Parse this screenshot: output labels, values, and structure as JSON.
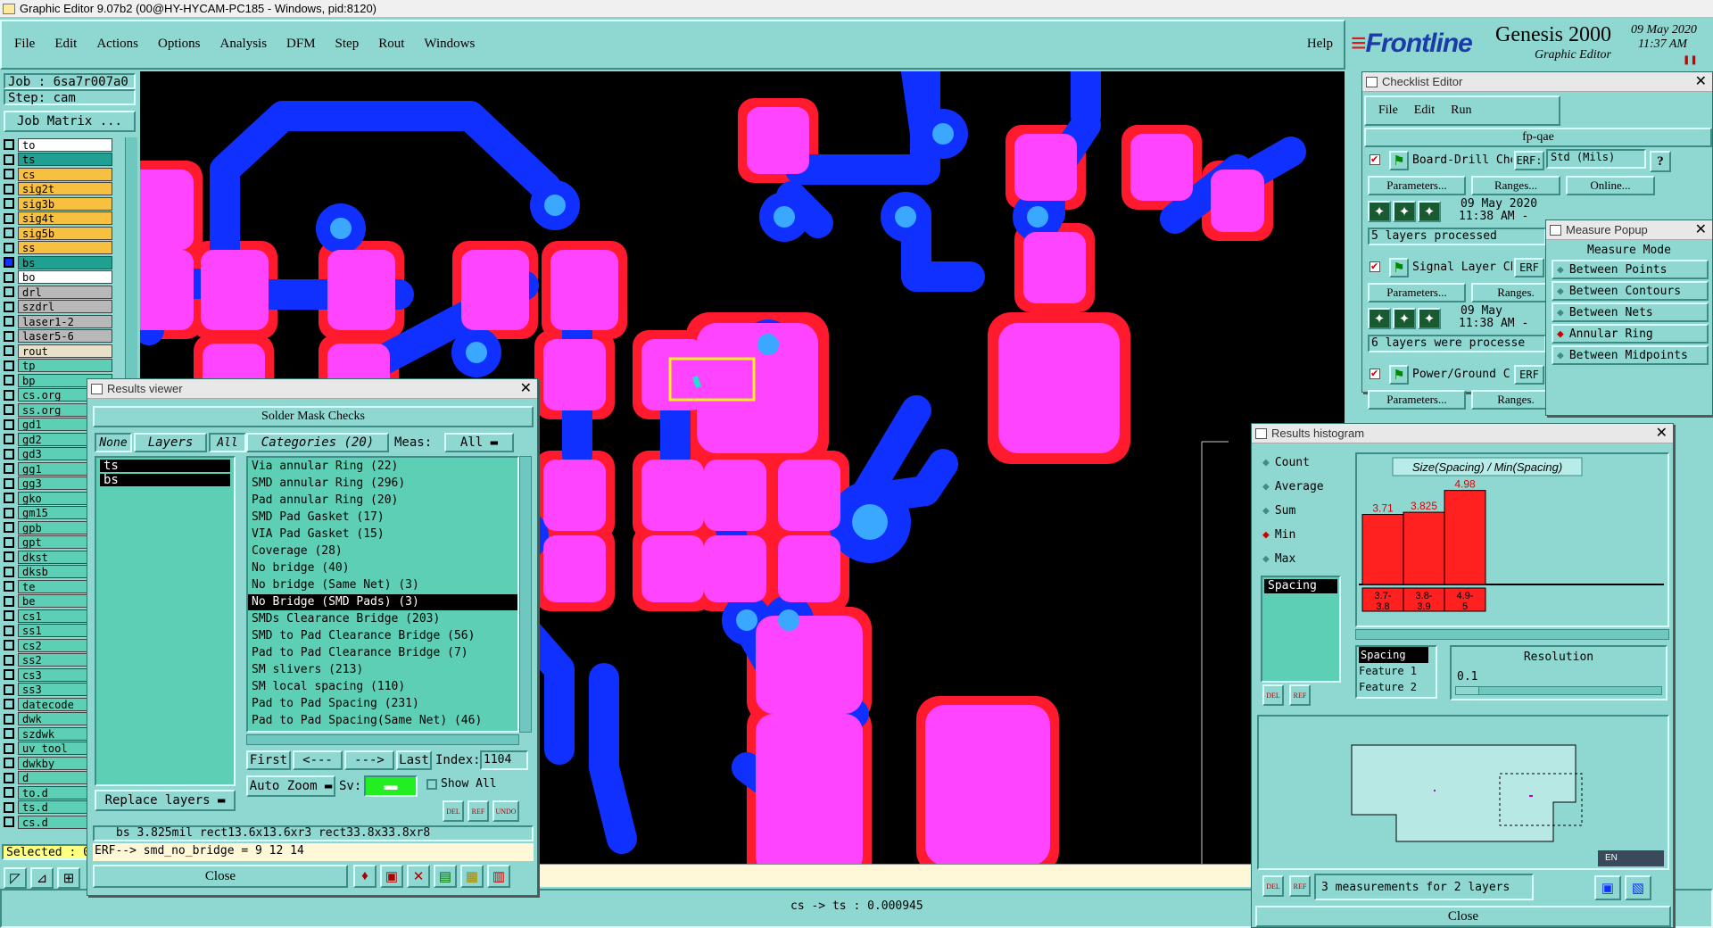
{
  "window": {
    "title": "Graphic Editor 9.07b2 (00@HY-HYCAM-PC185 - Windows, pid:8120)"
  },
  "menu": {
    "items": [
      "File",
      "Edit",
      "Actions",
      "Options",
      "Analysis",
      "DFM",
      "Step",
      "Rout",
      "Windows"
    ],
    "help": "Help"
  },
  "brand": {
    "logo": "Frontline",
    "product": "Genesis 2000",
    "subtitle": "Graphic Editor",
    "date": "09 May 2020",
    "time": "11:37 AM"
  },
  "job": {
    "job": "Job : 6sa7r007a0",
    "step": "Step: cam",
    "matrix_button": "Job Matrix ..."
  },
  "layers": [
    {
      "name": "to",
      "color": "#ffffff"
    },
    {
      "name": "ts",
      "color": "#20a090"
    },
    {
      "name": "cs",
      "color": "#f8c040"
    },
    {
      "name": "sig2t",
      "color": "#f8c040"
    },
    {
      "name": "sig3b",
      "color": "#f8c040"
    },
    {
      "name": "sig4t",
      "color": "#f8c040"
    },
    {
      "name": "sig5b",
      "color": "#f8c040"
    },
    {
      "name": "ss",
      "color": "#f8c040"
    },
    {
      "name": "bs",
      "color": "#20a090"
    },
    {
      "name": "bo",
      "color": "#ffffff"
    },
    {
      "name": "drl",
      "color": "#b8b8b8"
    },
    {
      "name": "szdrl",
      "color": "#b8b8b8"
    },
    {
      "name": "laser1-2",
      "color": "#b8b8b8"
    },
    {
      "name": "laser5-6",
      "color": "#b8b8b8"
    },
    {
      "name": "rout",
      "color": "#e8e0c8"
    },
    {
      "name": "tp",
      "color": "#5ccfb4"
    },
    {
      "name": "bp",
      "color": "#5ccfb4"
    },
    {
      "name": "cs.org",
      "color": "#5ccfb4"
    },
    {
      "name": "ss.org",
      "color": "#5ccfb4"
    },
    {
      "name": "gd1",
      "color": "#5ccfb4"
    },
    {
      "name": "gd2",
      "color": "#5ccfb4"
    },
    {
      "name": "gd3",
      "color": "#5ccfb4"
    },
    {
      "name": "gg1",
      "color": "#5ccfb4"
    },
    {
      "name": "gg3",
      "color": "#5ccfb4"
    },
    {
      "name": "gko",
      "color": "#5ccfb4"
    },
    {
      "name": "gm15",
      "color": "#5ccfb4"
    },
    {
      "name": "gpb",
      "color": "#5ccfb4"
    },
    {
      "name": "gpt",
      "color": "#5ccfb4"
    },
    {
      "name": "dkst",
      "color": "#5ccfb4"
    },
    {
      "name": "dksb",
      "color": "#5ccfb4"
    },
    {
      "name": "te",
      "color": "#5ccfb4"
    },
    {
      "name": "be",
      "color": "#5ccfb4"
    },
    {
      "name": "cs1",
      "color": "#5ccfb4"
    },
    {
      "name": "ss1",
      "color": "#5ccfb4"
    },
    {
      "name": "cs2",
      "color": "#5ccfb4"
    },
    {
      "name": "ss2",
      "color": "#5ccfb4"
    },
    {
      "name": "cs3",
      "color": "#5ccfb4"
    },
    {
      "name": "ss3",
      "color": "#5ccfb4"
    },
    {
      "name": "datecode",
      "color": "#5ccfb4"
    },
    {
      "name": "dwk",
      "color": "#5ccfb4"
    },
    {
      "name": "szdwk",
      "color": "#5ccfb4"
    },
    {
      "name": "uv_tool",
      "color": "#5ccfb4"
    },
    {
      "name": "dwkby",
      "color": "#5ccfb4"
    },
    {
      "name": "d",
      "color": "#5ccfb4"
    },
    {
      "name": "to.d",
      "color": "#5ccfb4"
    },
    {
      "name": "ts.d",
      "color": "#5ccfb4"
    },
    {
      "name": "cs.d",
      "color": "#5ccfb4"
    }
  ],
  "selected_label": "Selected : 0",
  "results_viewer": {
    "title": "Results viewer",
    "header": "Solder Mask Checks",
    "none": "None",
    "layers_tab": "Layers",
    "all": "All",
    "categories_tab": "Categories (20)",
    "meas_label": "Meas:",
    "meas_value": "All",
    "layer_list": [
      "ts",
      "bs"
    ],
    "categories": [
      "Via annular Ring (22)",
      "SMD annular Ring (296)",
      "Pad annular Ring (20)",
      "SMD Pad Gasket (17)",
      "VIA Pad Gasket (15)",
      "Coverage (28)",
      "No bridge (40)",
      "No bridge (Same Net) (3)",
      "No Bridge (SMD Pads) (3)",
      "SMDs Clearance Bridge (203)",
      "SMD to Pad Clearance Bridge (56)",
      "Pad to Pad Clearance Bridge (7)",
      "SM slivers (213)",
      "SM local spacing (110)",
      "Pad to Pad Spacing (231)",
      "Pad to Pad Spacing(Same Net) (46)"
    ],
    "selected_category": "No Bridge (SMD Pads) (3)",
    "nav": {
      "first": "First",
      "prev": "<---",
      "next": "--->",
      "last": "Last",
      "index_label": "Index:",
      "index_value": "1104"
    },
    "auto_zoom": "Auto Zoom",
    "sv": "Sv:",
    "show_all": "Show All",
    "replace_layers": "Replace layers",
    "measure_info": "bs 3.825mil   rect13.6x13.6xr3   rect33.8x33.8xr8",
    "erf": "ERF--> smd_no_bridge = 9 12 14",
    "close": "Close",
    "del": "DEL",
    "ref": "REF",
    "undo": "UNDO"
  },
  "checklist": {
    "title": "Checklist Editor",
    "menu": [
      "File",
      "Edit",
      "Run"
    ],
    "name": "fp-qae",
    "rows": [
      {
        "label": "Board-Drill Che",
        "erf": "ERF:",
        "erf_value": "Std (Mils)",
        "params": "Parameters...",
        "ranges": "Ranges...",
        "online": "Online...",
        "date": "09 May 2020",
        "time": "11:38 AM -",
        "status": "5 layers processed"
      },
      {
        "label": "Signal Layer Ch",
        "erf": "ERF",
        "params": "Parameters...",
        "ranges": "Ranges.",
        "date": "09 May",
        "time": "11:38 AM -",
        "status": "6 layers were processe"
      },
      {
        "label": "Power/Ground C",
        "erf": "ERF",
        "params": "Parameters...",
        "ranges": "Ranges."
      }
    ]
  },
  "measure_popup": {
    "title": "Measure Popup",
    "mode": "Measure Mode",
    "options": [
      "Between Points",
      "Between Contours",
      "Between Nets",
      "Annular Ring",
      "Between Midpoints"
    ],
    "selected": "Annular Ring"
  },
  "histogram": {
    "title": "Results histogram",
    "modes": [
      "Count",
      "Average",
      "Sum",
      "Min",
      "Max"
    ],
    "selected_mode": "Min",
    "measure_list": [
      "Spacing"
    ],
    "chart_title": "Size(Spacing) / Min(Spacing)",
    "footer_status": "3 measurements for 2 layers",
    "close": "Close",
    "spacing_items": [
      "Spacing",
      "Feature 1",
      "Feature 2"
    ],
    "resolution_label": "Resolution",
    "resolution_value": "0.1",
    "del": "DEL",
    "ref": "REF"
  },
  "chart_data": {
    "type": "bar",
    "title": "Size(Spacing) / Min(Spacing)",
    "categories": [
      "3.7-3.8",
      "3.8-3.9",
      "4.9-5"
    ],
    "values": [
      3.71,
      3.825,
      4.98
    ],
    "ylim": [
      0,
      5.2
    ]
  },
  "status_bar": "cs -> ts : 0.000945",
  "lang": "EN",
  "colors": {
    "bg": "#8fd8d2",
    "list": "#5ccfb4",
    "canvas": "#000000",
    "pad": "#ff44ff",
    "mask": "#ff1a2e",
    "trace": "#1030ff",
    "via_center": "#3aa8ff",
    "highlight": "#ffee22",
    "bar": "#ff2020"
  }
}
